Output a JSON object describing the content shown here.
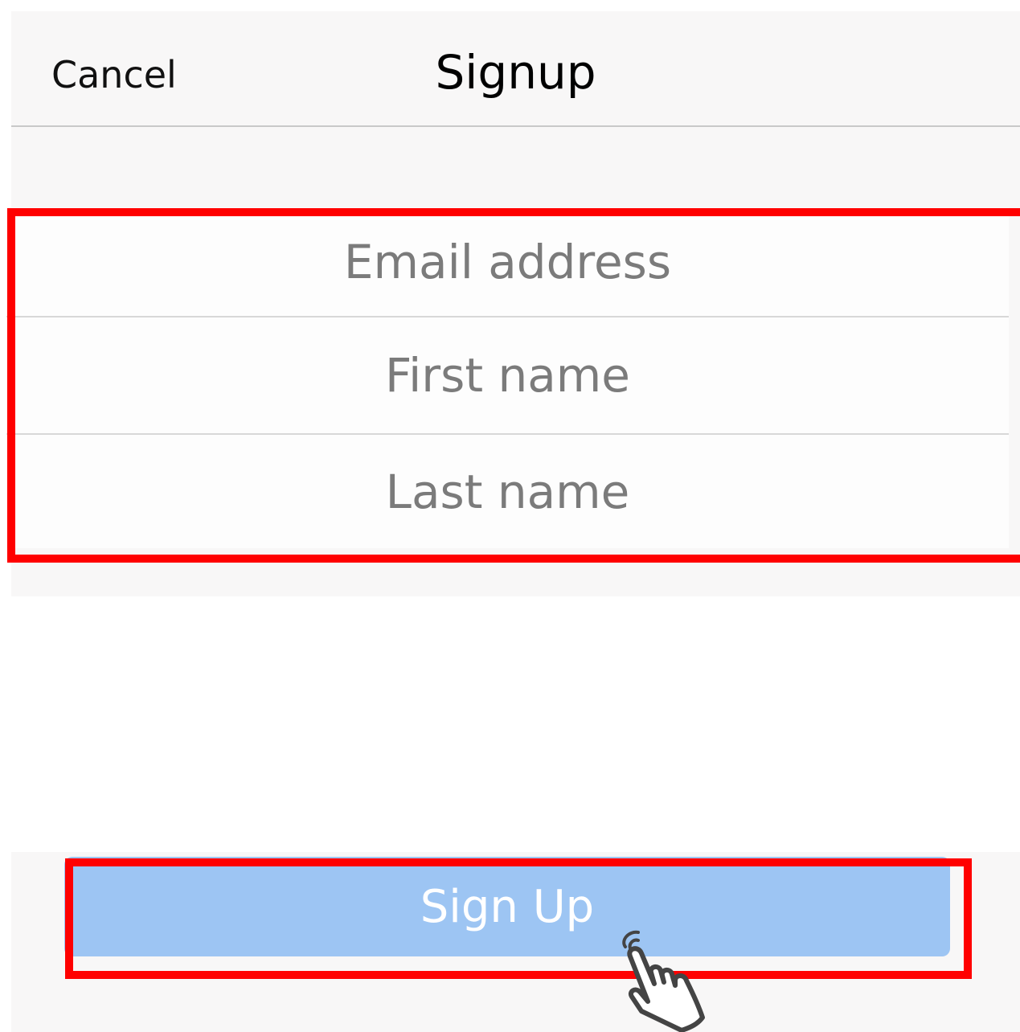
{
  "navbar": {
    "cancel_label": "Cancel",
    "title": "Signup"
  },
  "form": {
    "email_placeholder": "Email address",
    "first_name_placeholder": "First name",
    "last_name_placeholder": "Last name"
  },
  "actions": {
    "signup_label": "Sign Up"
  },
  "colors": {
    "accent": "#9dc5f3",
    "highlight": "#ff0000",
    "background": "#f8f7f7"
  },
  "icons": {
    "pointer": "tap-hand-icon"
  }
}
